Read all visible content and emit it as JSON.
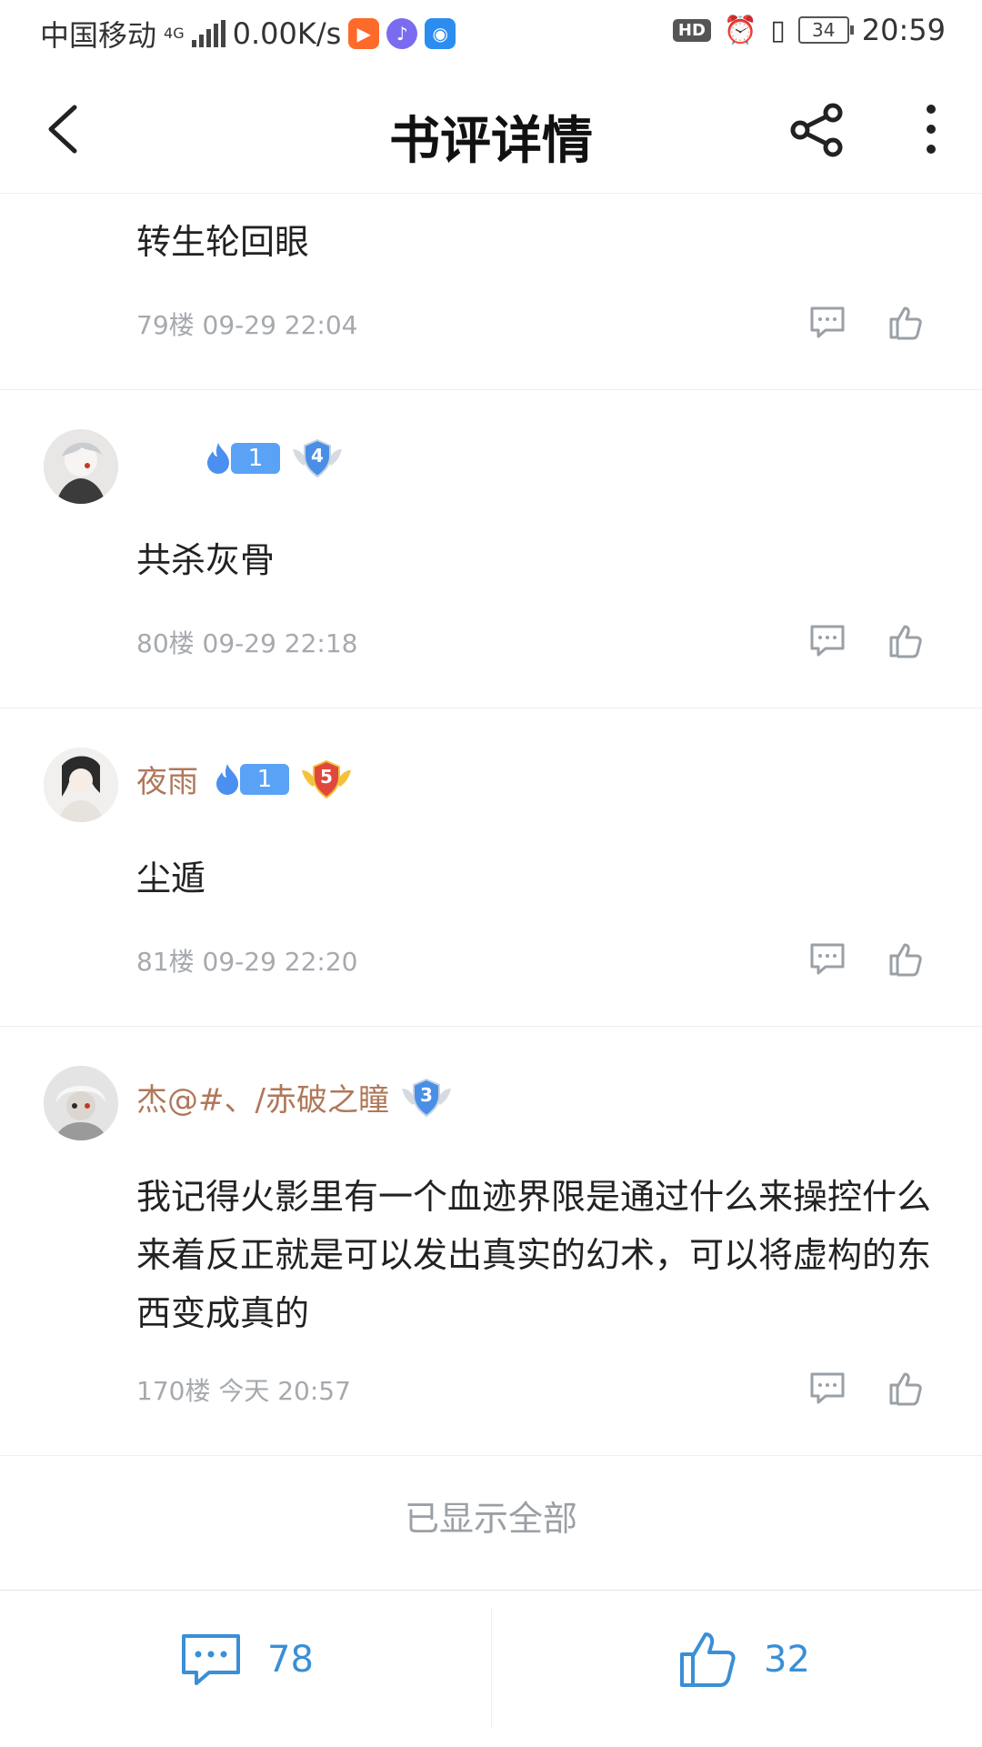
{
  "status_bar": {
    "carrier": "中国移动",
    "network": "4G",
    "speed": "0.00K/s",
    "battery": "34",
    "time": "20:59",
    "hd_label": "HD"
  },
  "header": {
    "title": "书评详情"
  },
  "comments": [
    {
      "username": "",
      "fire_level": "",
      "shield_level": "",
      "text": "转生轮回眼",
      "floor_time": "79楼 09-29 22:04"
    },
    {
      "username": "",
      "fire_level": "1",
      "shield_level": "4",
      "text": "共杀灰骨",
      "floor_time": "80楼 09-29 22:18"
    },
    {
      "username": "夜雨",
      "fire_level": "1",
      "shield_level": "5",
      "text": "尘遁",
      "floor_time": "81楼 09-29 22:20"
    },
    {
      "username": "杰@#、/赤破之瞳",
      "fire_level": "",
      "shield_level": "3",
      "text": "我记得火影里有一个血迹界限是通过什么来操控什么来着反正就是可以发出真实的幻术，可以将虚构的东西变成真的",
      "floor_time": "170楼 今天 20:57"
    }
  ],
  "footer_note": "已显示全部",
  "bottom_bar": {
    "comment_count": "78",
    "like_count": "32"
  },
  "colors": {
    "accent": "#3a8fd6",
    "username": "#b0785a",
    "meta": "#a6a9ae"
  }
}
